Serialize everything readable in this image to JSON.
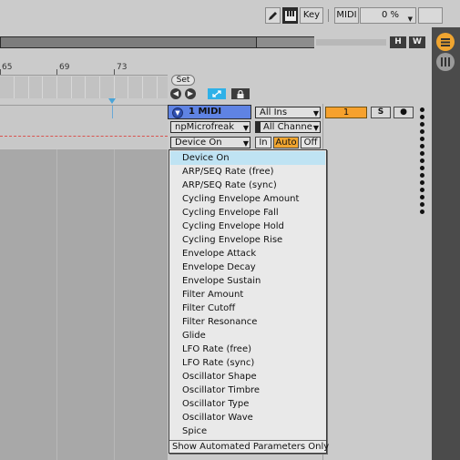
{
  "toolbar": {
    "pencil_icon": "pencil-icon",
    "keyboard_icon": "piano-keyboard-icon",
    "key_label": "Key",
    "midi_label": "MIDI",
    "zoom_value": "0 %"
  },
  "overview": {
    "h_label": "H",
    "w_label": "W"
  },
  "ruler": {
    "ticks": [
      "65",
      "69",
      "73"
    ]
  },
  "set_controls": {
    "set_label": "Set",
    "back_symbol": "◀",
    "fwd_symbol": "▶"
  },
  "track": {
    "fold_symbol": "▼",
    "name": "1 MIDI",
    "device_select": "npMicrofreak",
    "param_select": "Device On",
    "input_type": "All Ins",
    "input_channel": "All Channe",
    "monitor": {
      "in": "In",
      "auto": "Auto",
      "off": "Off"
    },
    "arm_number": "1",
    "solo": "S",
    "record_symbol": "●"
  },
  "dropdown": {
    "items": [
      "Device On",
      "ARP/SEQ Rate (free)",
      "ARP/SEQ Rate (sync)",
      "Cycling Envelope Amount",
      "Cycling Envelope Fall",
      "Cycling Envelope Hold",
      "Cycling Envelope Rise",
      "Envelope Attack",
      "Envelope Decay",
      "Envelope Sustain",
      "Filter Amount",
      "Filter Cutoff",
      "Filter Resonance",
      "Glide",
      "LFO Rate (free)",
      "LFO Rate (sync)",
      "Oscillator Shape",
      "Oscillator Timbre",
      "Oscillator Type",
      "Oscillator Wave",
      "Spice"
    ],
    "selected": "Device On",
    "footer": "Show Automated Parameters Only"
  },
  "colors": {
    "track_header": "#5f83e3",
    "arm_orange": "#f6a12d",
    "auto_orange": "#f0a530",
    "follow_blue": "#2fb1e8",
    "dropdown_highlight": "#bfe3f3"
  }
}
